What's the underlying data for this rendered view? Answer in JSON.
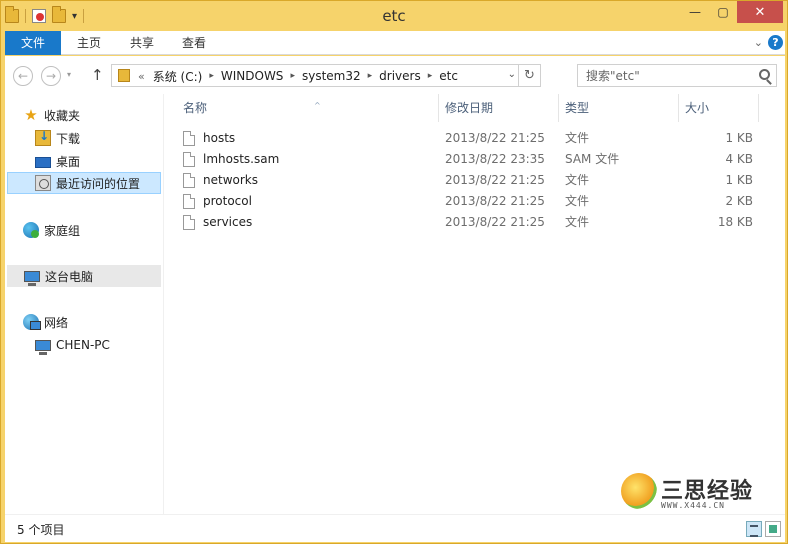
{
  "window": {
    "title": "etc"
  },
  "quick_access": {
    "dropdown": "▾"
  },
  "controls": {
    "minimize": "—",
    "maximize": "▢",
    "close": "✕"
  },
  "ribbon": {
    "tabs": [
      "文件",
      "主页",
      "共享",
      "查看"
    ],
    "collapse": "⌄",
    "help": "?"
  },
  "nav": {
    "back": "←",
    "forward": "→",
    "recent": "▾",
    "up": "↑",
    "address_lead": "«",
    "breadcrumbs": [
      "系统 (C:)",
      "WINDOWS",
      "system32",
      "drivers",
      "etc"
    ],
    "breadcrumb_sep": "▸",
    "dropdown": "⌄",
    "refresh": "↻"
  },
  "search": {
    "placeholder": "搜索\"etc\""
  },
  "navpane": {
    "favorites": "收藏夹",
    "downloads": "下载",
    "desktop": "桌面",
    "recent": "最近访问的位置",
    "homegroup": "家庭组",
    "this_pc": "这台电脑",
    "network": "网络",
    "computer": "CHEN-PC"
  },
  "columns": {
    "name": "名称",
    "date": "修改日期",
    "type": "类型",
    "size": "大小",
    "sort_indicator": "^"
  },
  "files": [
    {
      "name": "hosts",
      "date": "2013/8/22 21:25",
      "type": "文件",
      "size": "1 KB"
    },
    {
      "name": "lmhosts.sam",
      "date": "2013/8/22 23:35",
      "type": "SAM 文件",
      "size": "4 KB"
    },
    {
      "name": "networks",
      "date": "2013/8/22 21:25",
      "type": "文件",
      "size": "1 KB"
    },
    {
      "name": "protocol",
      "date": "2013/8/22 21:25",
      "type": "文件",
      "size": "2 KB"
    },
    {
      "name": "services",
      "date": "2013/8/22 21:25",
      "type": "文件",
      "size": "18 KB"
    }
  ],
  "status": {
    "item_count": "5 个项目"
  },
  "watermark": {
    "title": "三思经验",
    "url": "WWW.X444.CN"
  },
  "colors": {
    "accent": "#1979ca",
    "frame": "#f6d36b",
    "selection": "#cce8ff"
  }
}
